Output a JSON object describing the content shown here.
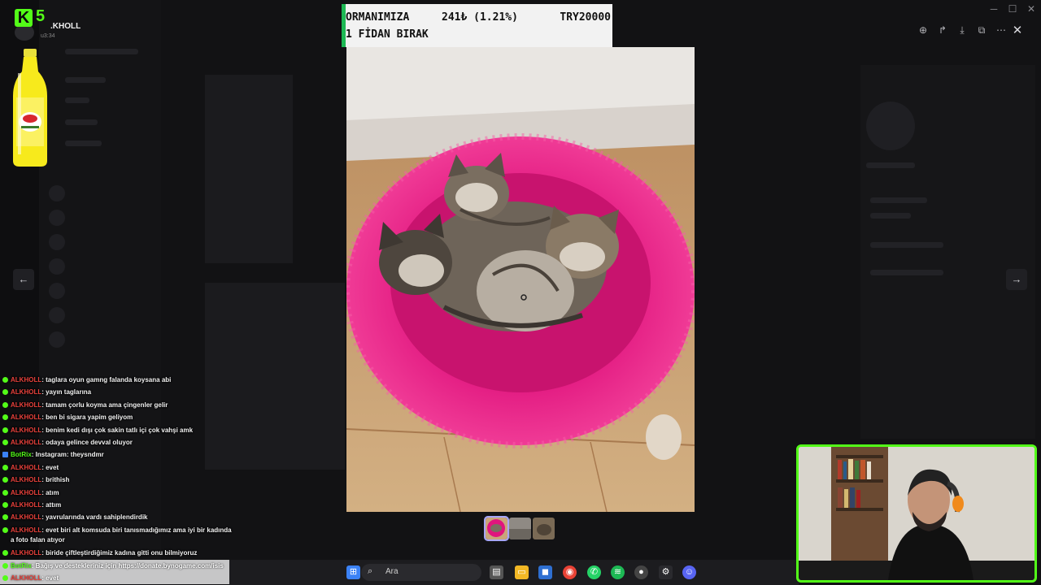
{
  "stream": {
    "logo_letter": "K",
    "logo_number": "5",
    "channel_name": ".KHOLL",
    "uptime": "u3:34"
  },
  "donation": {
    "line1": "ORMANIMIZA",
    "amount_pct": "241₺ (1.21%)",
    "goal": "TRY20000",
    "line2": "1 FİDAN BIRAK",
    "progress_fraction": 0.0121
  },
  "viewer": {
    "tools": [
      "zoom-in-icon",
      "forward-icon",
      "download-icon",
      "open-external-icon",
      "more-icon"
    ],
    "close": "✕",
    "prev": "←",
    "next": "→",
    "thumbnail_count": 3,
    "active_thumbnail": 0
  },
  "chat": [
    {
      "user": "ALKHOLL",
      "text": ": taglara oyun gamng falanda koysana abi",
      "bot": false
    },
    {
      "user": "ALKHOLL",
      "text": ": yayın taglarına",
      "bot": false
    },
    {
      "user": "ALKHOLL",
      "text": ": tamam çorlu koyma ama çingenler gelir",
      "bot": false
    },
    {
      "user": "ALKHOLL",
      "text": ": ben bi sigara yapim geliyom",
      "bot": false
    },
    {
      "user": "ALKHOLL",
      "text": ": benim kedi dışı çok sakin tatlı içi çok vahşi amk",
      "bot": false
    },
    {
      "user": "ALKHOLL",
      "text": ": odaya gelince devval oluyor",
      "bot": false
    },
    {
      "user": "BotRix",
      "text": ": Instagram: theysndmr",
      "bot": true
    },
    {
      "user": "ALKHOLL",
      "text": ": evet",
      "bot": false
    },
    {
      "user": "ALKHOLL",
      "text": ": brithish",
      "bot": false
    },
    {
      "user": "ALKHOLL",
      "text": ": atım",
      "bot": false
    },
    {
      "user": "ALKHOLL",
      "text": ": attım",
      "bot": false
    },
    {
      "user": "ALKHOLL",
      "text": ": yavrularında vardı sahiplendirdik",
      "bot": false
    },
    {
      "user": "ALKHOLL",
      "text": ": evet biri alt komsuda biri tanısmadığımız ama iyi bir kadında a foto falan atıyor",
      "bot": false,
      "wrap": true
    },
    {
      "user": "ALKHOLL",
      "text": ": biride çiftleştirdiğimiz kadına gitti onu bilmiyoruz",
      "bot": false
    }
  ],
  "chat_banner": [
    {
      "user": "BotRix",
      "text": ": Bağış ve destekleriniz için https://donate.bynogame.com/isis",
      "bot": true
    },
    {
      "user": "ALKHOLL",
      "text": ": evet",
      "bot": false
    }
  ],
  "taskbar": {
    "search_label": "Ara",
    "icons": [
      "windows-start-icon",
      "search-icon",
      "file-explorer-icon",
      "folder-icon",
      "store-icon",
      "chrome-icon",
      "whatsapp-icon",
      "spotify-icon",
      "app-icon",
      "settings-icon",
      "discord-icon"
    ]
  },
  "colors": {
    "kick_green": "#53fc18",
    "chat_user_red": "#e8413b",
    "bed_pink": "#e0157e"
  }
}
